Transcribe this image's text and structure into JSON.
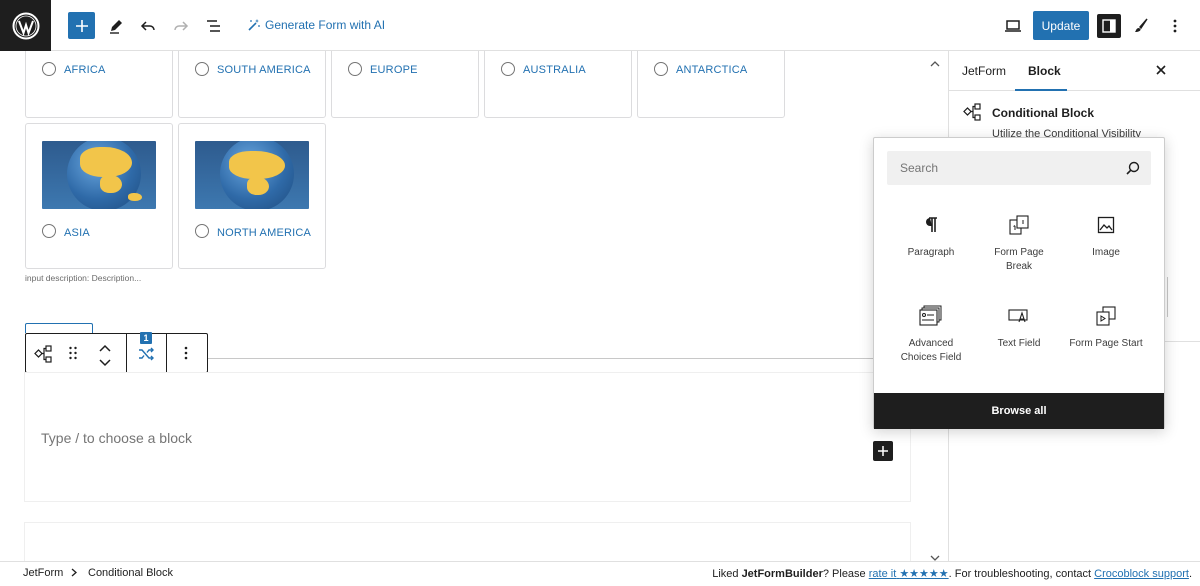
{
  "topbar": {
    "generate_ai_label": "Generate Form with AI",
    "update_label": "Update"
  },
  "choices": [
    {
      "label": "AFRICA"
    },
    {
      "label": "SOUTH AMERICA"
    },
    {
      "label": "EUROPE"
    },
    {
      "label": "AUSTRALIA"
    },
    {
      "label": "ANTARCTICA"
    },
    {
      "label": "ASIA"
    },
    {
      "label": "NORTH AMERICA"
    }
  ],
  "input_description": "input description:   Description...",
  "block_toolbar": {
    "badge": "1"
  },
  "empty_block": {
    "placeholder": "Type / to choose a block"
  },
  "sidebar": {
    "tabs": [
      "JetForm",
      "Block"
    ],
    "active_tab": "Block",
    "block_title": "Conditional Block",
    "block_desc": "Utilize the Conditional Visibility"
  },
  "inserter": {
    "search_placeholder": "Search",
    "items": [
      {
        "label": "Paragraph",
        "icon": "paragraph-icon"
      },
      {
        "label": "Form Page Break",
        "icon": "form-page-break-icon"
      },
      {
        "label": "Image",
        "icon": "image-icon"
      },
      {
        "label": "Advanced Choices Field",
        "icon": "advanced-choices-icon"
      },
      {
        "label": "Text Field",
        "icon": "text-field-icon"
      },
      {
        "label": "Form Page Start",
        "icon": "form-page-start-icon"
      }
    ],
    "browse_all_label": "Browse all"
  },
  "footer": {
    "breadcrumb": [
      "JetForm",
      "Conditional Block"
    ],
    "liked_prefix": "Liked ",
    "product": "JetFormBuilder",
    "please": "? Please ",
    "rate_it": "rate it",
    "stars": "★★★★★",
    "troubleshoot": ". For troubleshooting, contact ",
    "support_link": "Crocoblock support",
    "end": "."
  },
  "colors": {
    "accent": "#2271b1",
    "dark": "#1e1e1e"
  }
}
